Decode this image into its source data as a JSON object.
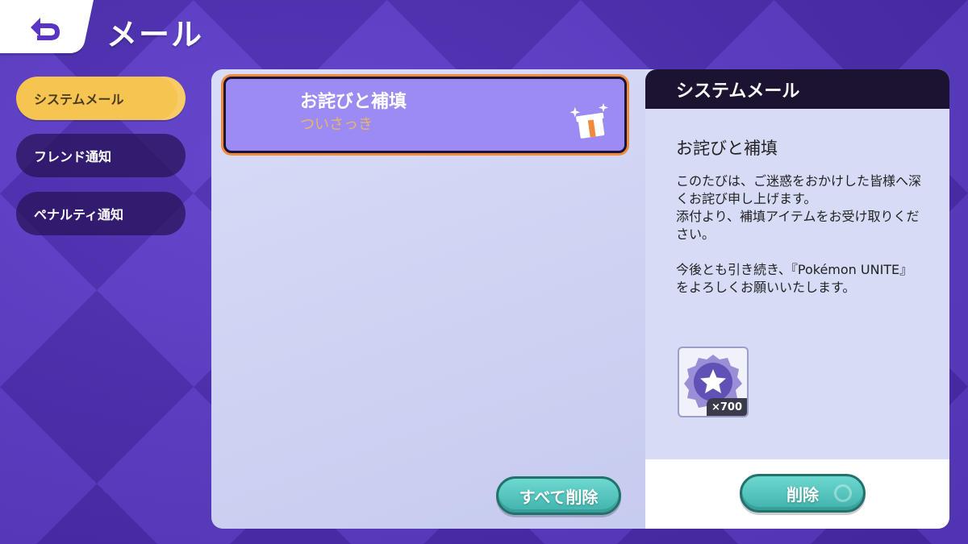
{
  "header": {
    "title": "メール",
    "back_icon": "back-arrow-icon"
  },
  "sidebar": {
    "items": [
      {
        "label": "システムメール",
        "active": true
      },
      {
        "label": "フレンド通知",
        "active": false
      },
      {
        "label": "ペナルティ通知",
        "active": false
      }
    ]
  },
  "mail_list": {
    "items": [
      {
        "subject": "お詫びと補填",
        "time": "ついさっき",
        "icon": "gift-icon"
      }
    ],
    "delete_all_label": "すべて削除"
  },
  "detail": {
    "header": "システムメール",
    "title": "お詫びと補填",
    "body_p1": "このたびは、ご迷惑をおかけした皆様へ深くお詫び申し上げます。\n添付より、補填アイテムをお受け取りください。",
    "body_p2": "今後とも引き続き、『Pokémon UNITE』をよろしくお願いいたします。",
    "reward": {
      "icon": "star-badge-icon",
      "quantity": "×700"
    },
    "delete_label": "削除"
  },
  "colors": {
    "background": "#5b3bc9",
    "active_tab": "#f6c451",
    "mail_item": "#9b8bf3",
    "highlight": "#f08a3d",
    "button": "#3eb3ac",
    "detail_header": "#1b132f"
  }
}
